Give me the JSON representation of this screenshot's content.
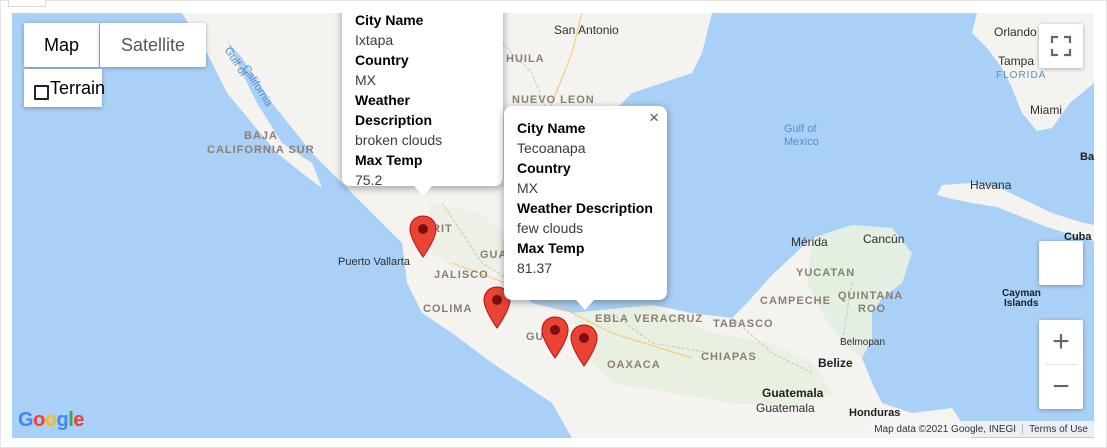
{
  "map": {
    "type_control": {
      "map_label": "Map",
      "satellite_label": "Satellite",
      "selected": "Map"
    },
    "terrain_label": "Terrain",
    "labels": {
      "san_antonio": "San Antonio",
      "orlando": "Orlando",
      "tampa": "Tampa",
      "florida": "FLORIDA",
      "miami": "Miami",
      "bahamas": "Bal",
      "gulf_california_1": "Gulf of",
      "gulf_california_2": "California",
      "baja_1": "BAJA",
      "baja_2": "CALIFORNIA SUR",
      "coahuila": "HUILA",
      "nuevo_leon": "NUEVO LEON",
      "gulf_mexico_1": "Gulf of",
      "gulf_mexico_2": "Mexico",
      "havana": "Havana",
      "cuba": "Cuba",
      "merida": "Mérida",
      "cancun": "Cancún",
      "yucatan": "YUCATAN",
      "campeche": "CAMPECHE",
      "quintana_1": "QUINTANA",
      "quintana_2": "ROO",
      "cayman_1": "Cayman",
      "cayman_2": "Islands",
      "nayarit": "RIT",
      "puerto_vallarta": "Puerto Vallarta",
      "jalisco": "JALISCO",
      "gua": "GUA",
      "colima": "COLIMA",
      "puebla": "EBLA",
      "veracruz": "VERACRUZ",
      "tabasco": "TABASCO",
      "belmopan": "Belmopan",
      "belize": "Belize",
      "oaxaca": "OAXACA",
      "chiapas": "CHIAPAS",
      "guatemala_1": "Guatemala",
      "guatemala_2": "Guatemala",
      "honduras": "Honduras",
      "gu_state": "GU"
    },
    "popups": [
      {
        "city_label": "City Name",
        "city": "Ixtapa",
        "country_label": "Country",
        "country": "MX",
        "weather_label": "Weather Description",
        "weather": "broken clouds",
        "temp_label": "Max Temp",
        "temp": "75.2"
      },
      {
        "city_label": "City Name",
        "city": "Tecoanapa",
        "country_label": "Country",
        "country": "MX",
        "weather_label": "Weather Description",
        "weather": "few clouds",
        "temp_label": "Max Temp",
        "temp": "81.37",
        "close_glyph": "×"
      }
    ],
    "zoom": {
      "in": "+",
      "out": "−"
    },
    "attribution": {
      "data": "Map data ©2021 Google, INEGI",
      "terms": "Terms of Use"
    },
    "logo": "Google",
    "colors": {
      "water": "#a9d0f6",
      "land": "#f5f3ef",
      "pin": "#ea4335"
    },
    "icons": [
      "fullscreen-icon",
      "map-pin-icon",
      "close-icon",
      "zoom-in-icon",
      "zoom-out-icon"
    ]
  }
}
